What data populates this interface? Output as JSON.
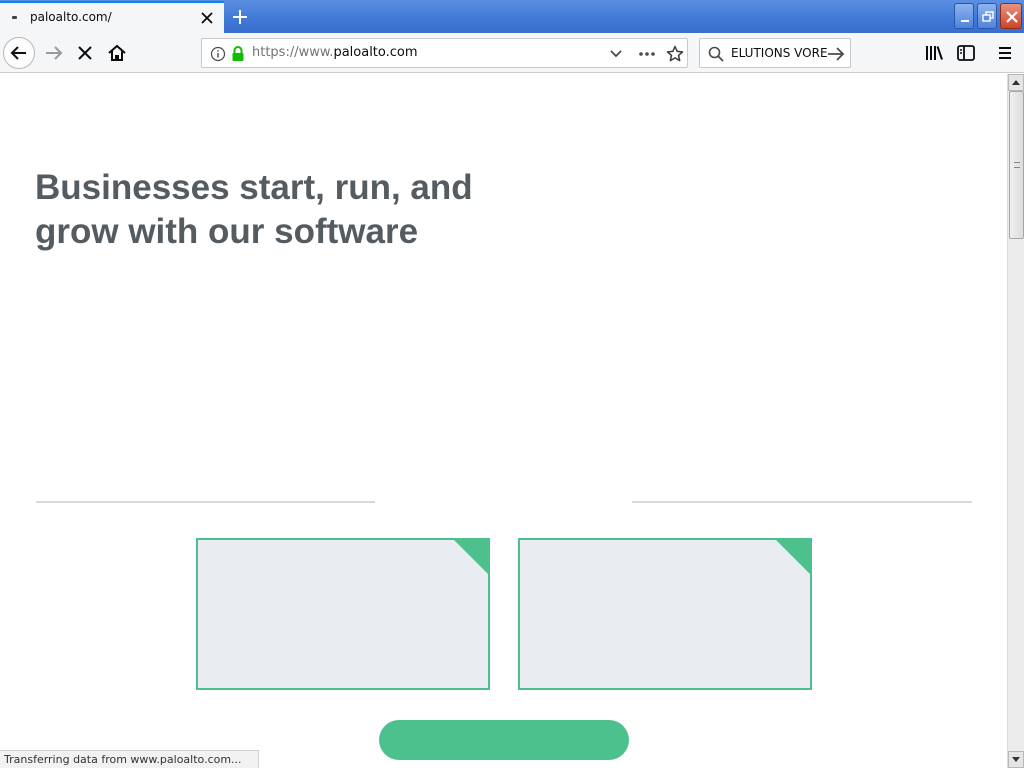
{
  "browser": {
    "tab": {
      "title": "paloalto.com/"
    },
    "urlbar": {
      "scheme": "https://www.",
      "host": "paloalto.com"
    },
    "searchbar": {
      "value": "ELUTIONS VORE"
    },
    "status_text": "Transferring data from www.paloalto.com...",
    "icons": {
      "back": "back-arrow-icon",
      "forward": "forward-arrow-icon",
      "stop": "stop-icon",
      "home": "home-icon",
      "info": "info-icon",
      "lock": "lock-icon",
      "dropdown": "chevron-down-icon",
      "more": "more-icon",
      "bookmark": "star-icon",
      "search": "search-icon",
      "library": "library-icon",
      "sidebar": "sidebar-icon",
      "menu": "hamburger-menu-icon"
    },
    "colors": {
      "tab_accent": "#0a84ff",
      "lock_green": "#12bc00",
      "titlebar_blue": "#3f78d6"
    }
  },
  "page": {
    "hero": {
      "line1": "Businesses start, run, and",
      "line2": "grow with our software"
    },
    "colors": {
      "brand_green": "#4cc08d",
      "card_bg": "#e9edf2",
      "heading": "#545c62"
    }
  }
}
